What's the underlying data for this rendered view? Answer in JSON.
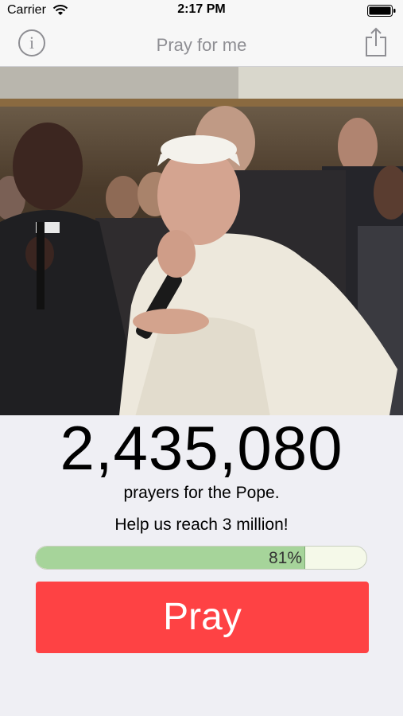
{
  "status_bar": {
    "carrier": "Carrier",
    "time": "2:17 PM"
  },
  "nav": {
    "title": "Pray for me",
    "info_icon": "info-icon",
    "share_icon": "share-icon"
  },
  "hero": {
    "description_icon": "photo"
  },
  "counter": {
    "value": "2,435,080"
  },
  "texts": {
    "line1": "prayers for the Pope.",
    "line2": "Help us reach 3 million!"
  },
  "progress": {
    "percent": 81,
    "label": "81%"
  },
  "pray_button": {
    "label": "Pray",
    "color": "#fe4244"
  },
  "colors": {
    "accent_gray": "#8e8e93",
    "progress_fill": "#a6d49a"
  }
}
